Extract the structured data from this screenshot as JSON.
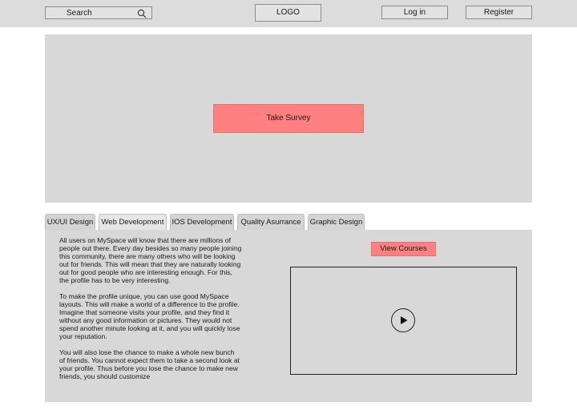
{
  "header": {
    "search_label": "Search",
    "search_icon": "search-icon",
    "logo": "LOGO",
    "login_label": "Log in",
    "register_label": "Register"
  },
  "hero": {
    "survey_label": "Take Survey",
    "accent_color": "#ff8080"
  },
  "tabs": [
    {
      "label": "UX/UI Design"
    },
    {
      "label": "Web Development",
      "active": true
    },
    {
      "label": "IOS Development"
    },
    {
      "label": "Quality Asurrance"
    },
    {
      "label": "Graphic Design"
    }
  ],
  "content": {
    "paragraphs": [
      "All users on MySpace will know that there are millions of people out there. Every day besides so many people joining this community, there are many others who will be looking out for friends. This will mean that they are naturally looking out for good people who are interesting enough. For this, the profile has to be very interesting.",
      "To make the profile unique, you can use good MySpace layouts. This will make a world of a difference to the profile. Imagine that someone visits your profile, and they find it without any good information or pictures. They would not spend another minute looking at it, and you will quickly lose your reputation.",
      "You will also lose the chance to make a whole new bunch of friends. You cannot expect them to take a second look at your profile. Thus before you lose the chance to make new friends, you should customize"
    ],
    "view_courses_label": "View Courses",
    "video_icon": "play-icon"
  }
}
